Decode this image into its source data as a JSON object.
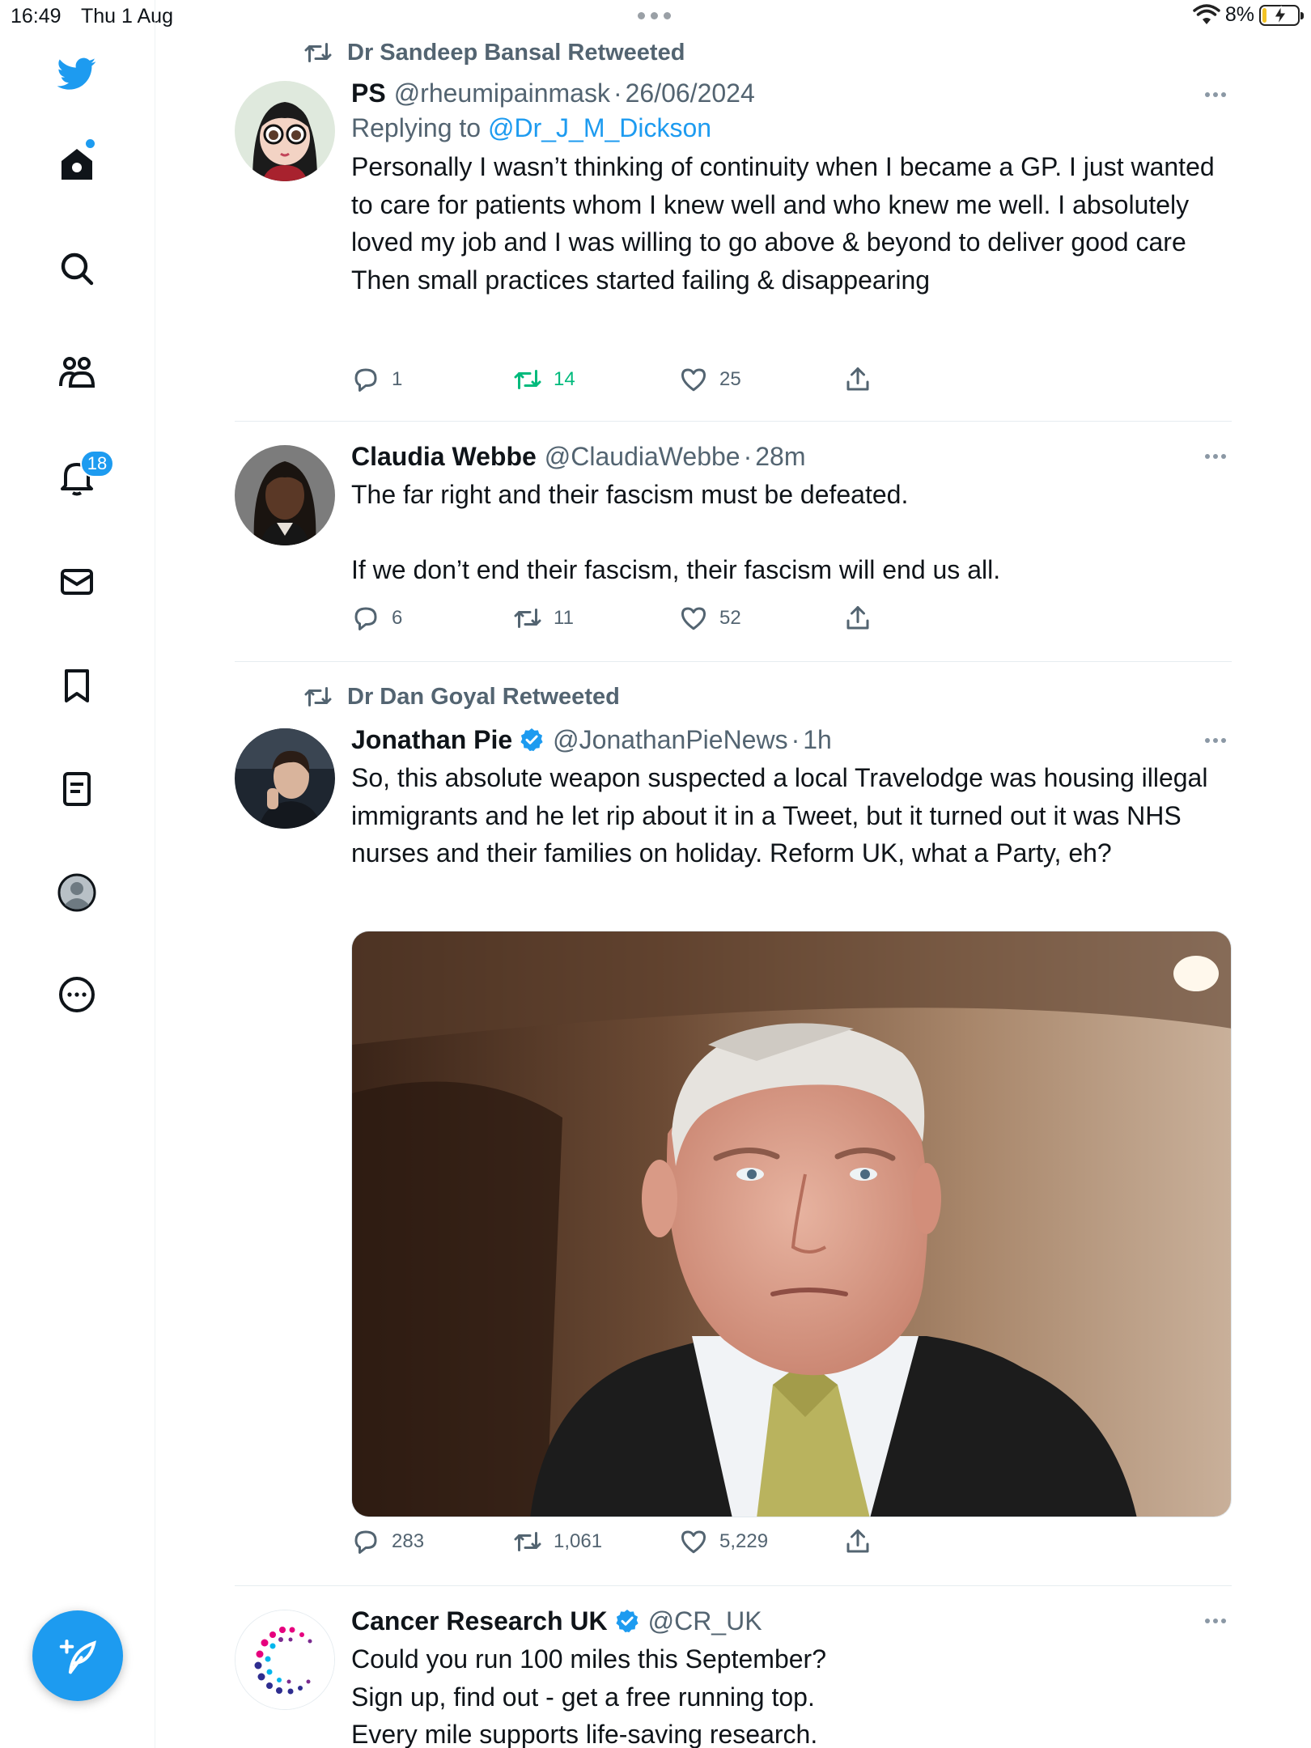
{
  "status_bar": {
    "time": "16:49",
    "date": "Thu 1 Aug",
    "battery_percent": "8%",
    "battery_level": 0.08,
    "charging": true
  },
  "sidebar": {
    "items": [
      {
        "name": "twitter-logo-icon"
      },
      {
        "name": "home-icon",
        "has_new_dot": true
      },
      {
        "name": "search-icon"
      },
      {
        "name": "communities-icon"
      },
      {
        "name": "notifications-icon",
        "badge": "18"
      },
      {
        "name": "messages-icon"
      },
      {
        "name": "bookmarks-icon"
      },
      {
        "name": "lists-icon"
      },
      {
        "name": "profile-icon"
      },
      {
        "name": "more-icon"
      }
    ],
    "compose_icon": "compose-feather-icon",
    "accent_color": "#1d9bf0"
  },
  "tweets": [
    {
      "social_context": "Dr Sandeep Bansal Retweeted",
      "name": "PS",
      "handle": "@rheumipainmask",
      "time": "26/06/2024",
      "verified": false,
      "replying_label": "Replying to",
      "replying_to": "@Dr_J_M_Dickson",
      "text": "Personally I wasn’t thinking of continuity when I became a GP. I just wanted to care for patients whom I knew well and who knew me well. I absolutely loved my job and I was willing to go above & beyond to deliver good care\nThen small practices started failing & disappearing",
      "replies": "1",
      "retweets": "14",
      "retweeted_by_me": true,
      "likes": "25"
    },
    {
      "name": "Claudia Webbe",
      "handle": "@ClaudiaWebbe",
      "time": "28m",
      "verified": false,
      "text": "The far right and their fascism must be defeated.\n\nIf we don’t end their fascism, their fascism will end us all.",
      "replies": "6",
      "retweets": "11",
      "likes": "52"
    },
    {
      "social_context": "Dr Dan Goyal Retweeted",
      "name": "Jonathan Pie",
      "handle": "@JonathanPieNews",
      "time": "1h",
      "verified": true,
      "text": "So, this absolute weapon suspected a local Travelodge was housing illegal immigrants and he let rip about it in a Tweet, but it turned out it was NHS nurses and their families on holiday. Reform UK, what a Party, eh?",
      "has_media": true,
      "replies": "283",
      "retweets": "1,061",
      "likes": "5,229"
    },
    {
      "name": "Cancer Research UK",
      "handle": "@CR_UK",
      "verified": true,
      "text": "Could you run 100 miles this September?\nSign up, find out - get a free running top.\nEvery mile supports life-saving research."
    }
  ],
  "separator": "·"
}
